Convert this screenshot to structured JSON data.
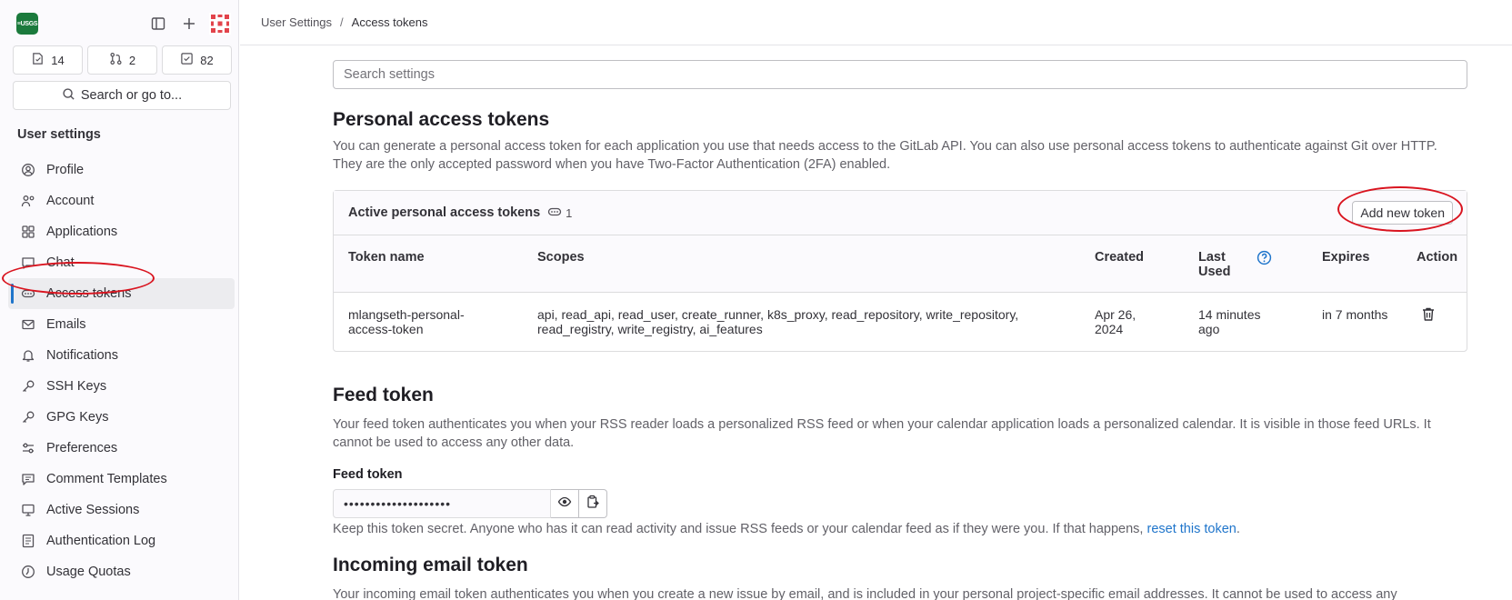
{
  "sidebar": {
    "logo_text": "≡USGS",
    "counts": [
      {
        "icon": "issues-icon",
        "value": "14"
      },
      {
        "icon": "merge-request-icon",
        "value": "2"
      },
      {
        "icon": "todo-icon",
        "value": "82"
      }
    ],
    "search_label": "Search or go to...",
    "heading": "User settings",
    "items": [
      {
        "label": "Profile",
        "icon": "profile-icon"
      },
      {
        "label": "Account",
        "icon": "account-icon"
      },
      {
        "label": "Applications",
        "icon": "applications-icon"
      },
      {
        "label": "Chat",
        "icon": "chat-icon"
      },
      {
        "label": "Access tokens",
        "icon": "token-icon",
        "active": true
      },
      {
        "label": "Emails",
        "icon": "mail-icon"
      },
      {
        "label": "Notifications",
        "icon": "bell-icon"
      },
      {
        "label": "SSH Keys",
        "icon": "key-icon"
      },
      {
        "label": "GPG Keys",
        "icon": "key-icon"
      },
      {
        "label": "Preferences",
        "icon": "preferences-icon"
      },
      {
        "label": "Comment Templates",
        "icon": "comment-icon"
      },
      {
        "label": "Active Sessions",
        "icon": "monitor-icon"
      },
      {
        "label": "Authentication Log",
        "icon": "log-icon"
      },
      {
        "label": "Usage Quotas",
        "icon": "quota-icon"
      }
    ]
  },
  "breadcrumb": {
    "parent": "User Settings",
    "separator": "/",
    "current": "Access tokens"
  },
  "search": {
    "placeholder": "Search settings"
  },
  "pat": {
    "title": "Personal access tokens",
    "description": "You can generate a personal access token for each application you use that needs access to the GitLab API. You can also use personal access tokens to authenticate against Git over HTTP. They are the only accepted password when you have Two-Factor Authentication (2FA) enabled.",
    "card_title": "Active personal access tokens",
    "count": "1",
    "add_button": "Add new token",
    "columns": {
      "name": "Token name",
      "scopes": "Scopes",
      "created": "Created",
      "last_used": "Last Used",
      "expires": "Expires",
      "action": "Action"
    },
    "row": {
      "name": "mlangseth-personal-access-token",
      "scopes": "api, read_api, read_user, create_runner, k8s_proxy, read_repository, write_repository, read_registry, write_registry, ai_features",
      "created": "Apr 26, 2024",
      "last_used": "14 minutes ago",
      "expires": "in 7 months"
    }
  },
  "feed": {
    "title": "Feed token",
    "description": "Your feed token authenticates you when your RSS reader loads a personalized RSS feed or when your calendar application loads a personalized calendar. It is visible in those feed URLs. It cannot be used to access any other data.",
    "label": "Feed token",
    "value": "••••••••••••••••••••",
    "help_text": "Keep this token secret. Anyone who has it can read activity and issue RSS feeds or your calendar feed as if they were you. If that happens, ",
    "help_link": "reset this token",
    "help_end": "."
  },
  "incoming": {
    "title": "Incoming email token",
    "description": "Your incoming email token authenticates you when you create a new issue by email, and is included in your personal project-specific email addresses. It cannot be used to access any"
  },
  "colors": {
    "accent": "#1f75cb",
    "annotation": "#d9141f",
    "brand": "#1b7a3c"
  }
}
